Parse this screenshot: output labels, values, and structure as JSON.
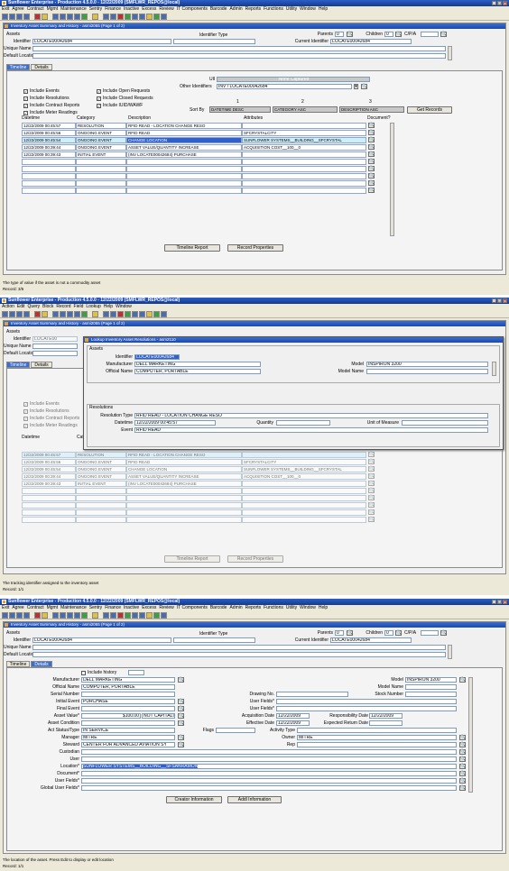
{
  "s1": {
    "title": "Sunflower Enterprise - Production 4.5.0.0 - 12/22/2009 (SMFLWR_REPOS@local)",
    "menu": [
      "Exit",
      "Agree",
      "Contract",
      "Mgmt",
      "Maintenance",
      "Sentry",
      "Finance",
      "Inactive",
      "Excess",
      "Review",
      "IT Components",
      "Barcode",
      "Admin",
      "Reports",
      "Functions",
      "Utility",
      "Window",
      "Help"
    ],
    "form_title": "Inventory Asset Summary and History - asmi2055 (Page 1 of 2)",
    "assets": "Assets",
    "identifier_label": "Identifier",
    "identifier": "LOCATE00042684",
    "identifier_type": "Identifier Type",
    "parents_label": "Parents",
    "parents": "0",
    "children_label": "Children",
    "children": "0",
    "cpa_label": "C/P/A",
    "current_identifier_label": "Current Identifier",
    "current_identifier": "LOCATE00042684",
    "unique_name_label": "Unique Name",
    "default_location_label": "Default Location*",
    "tabs": [
      "Timeline",
      "Details"
    ],
    "uii_label": "UII",
    "uii_value": "None Captured",
    "other_ids_label": "Other Identifiers",
    "other_ids": "INV / LOCATE00042684",
    "checks": [
      "Include Events",
      "Include Resolutions",
      "Include Contract Reports",
      "Include Meter Readings"
    ],
    "checks2": [
      "Include Open Requests",
      "Include Closed Requests",
      "Include IUID/WAWF"
    ],
    "sort_by": "Sort By",
    "n1": "1",
    "n2": "2",
    "n3": "3",
    "sort1": "DATETIME DESC",
    "sort2": "CATEGORY ASC",
    "sort3": "DESCRIPTION ASC",
    "get_records": "Get Records",
    "col_headers": [
      "Datetime",
      "Category",
      "Description",
      "Attributes",
      "Document?"
    ],
    "rows": [
      [
        "12/22/2009 00:45:57",
        "RESOLUTION",
        "RFID READ - LOCATION CHANGE RESO",
        ""
      ],
      [
        "12/22/2009 00:45:56",
        "ONGOING EVENT",
        "RFID READ",
        "SFCRYSTALCITY"
      ],
      [
        "12/22/2009 00:45:54",
        "ONGOING EVENT",
        "CHANGE LOCATION",
        "SUNFLOWER SYSTEMS__BUILDING__SFCRYSTAL"
      ],
      [
        "12/22/2009 00:39:44",
        "ONGOING EVENT",
        "ASSET VALUE/QUANTITY INCREASE",
        "ACQUISITION COST__100__0"
      ],
      [
        "12/22/2009 00:39:43",
        "INITIAL EVENT",
        "(INV LOCATE00042684) PURCHASE",
        ""
      ]
    ],
    "timeline_report": "Timeline Report",
    "record_properties": "Record Properties",
    "status": "The type of value if the asset is not a commodity asset",
    "record": "Record: 3/5"
  },
  "s2": {
    "title": "Sunflower Enterprise - Production 4.5.0.0 - 12/22/2009 (SMFLWR_REPOS@local)",
    "menu": [
      "Action",
      "Edit",
      "Query",
      "Block",
      "Record",
      "Field",
      "Lookup",
      "Help",
      "Window"
    ],
    "form_title": "Inventory Asset Summary and History - asmi2055 (Page 1 of 2)",
    "dlg_title": "Lookup Inventory Asset Resolutions - asm2110",
    "assets": "Assets",
    "identifier_label": "Identifier",
    "identifier": "LOCATE00042684",
    "manufacturer_label": "Manufacturer",
    "manufacturer": "DELL MARKETING",
    "official_name_label": "Official Name",
    "official_name": "COMPUTER, PORTABLE",
    "model_label": "Model",
    "model": "INSPIRON 3200",
    "model_name_label": "Model Name",
    "resolutions": "Resolutions",
    "res_type_label": "Resolution Type",
    "res_type": "RFID READ - LOCATION CHANGE RESO",
    "datetime_label": "Datetime",
    "datetime": "12/22/2009 00:45:57",
    "quantity_label": "Quantity",
    "uom_label": "Unit of Measure",
    "event_label": "Event",
    "event": "RFID READ",
    "bg_identifier": "LOCATE00",
    "unique_name_label": "Unique Name",
    "default_location_label": "Default Location*",
    "tabs": [
      "Timeline",
      "Details"
    ],
    "checks": [
      "Include Events",
      "Include Resolutions",
      "Include Contract Reports",
      "Include Meter Readings"
    ],
    "col_datetime": "Datetime",
    "col_cat": "Categ",
    "rows": [
      [
        "12/22/2009 00:45:57",
        "RESOLUTION",
        "RFID READ - LOCATION CHANGE RESO",
        ""
      ],
      [
        "12/22/2009 00:45:56",
        "ONGOING EVENT",
        "RFID READ",
        "SFCRYSTALCITY"
      ],
      [
        "12/22/2009 00:45:54",
        "ONGOING EVENT",
        "CHANGE LOCATION",
        "SUNFLOWER SYSTEMS__BUILDING__SFCRYSTAL"
      ],
      [
        "12/22/2009 00:39:44",
        "ONGOING EVENT",
        "ASSET VALUE/QUANTITY INCREASE",
        "ACQUISITION COST__100__0"
      ],
      [
        "12/22/2009 00:39:43",
        "INITIAL EVENT",
        "(INV LOCATE00042684) PURCHASE",
        ""
      ]
    ],
    "timeline_report": "Timeline Report",
    "record_properties": "Record Properties",
    "status": "The tracking identifier assigned to the inventory asset",
    "record": "Record: 1/1"
  },
  "s3": {
    "title": "Sunflower Enterprise - Production 4.5.0.0 - 12/22/2009 (SMFLWR_REPOS@local)",
    "menu": [
      "Exit",
      "Agree",
      "Contract",
      "Mgmt",
      "Maintenance",
      "Sentry",
      "Finance",
      "Inactive",
      "Excess",
      "Review",
      "IT Components",
      "Barcode",
      "Admin",
      "Reports",
      "Functions",
      "Utility",
      "Window",
      "Help"
    ],
    "form_title": "Inventory Asset Summary and History - asmi2055 (Page 1 of 2)",
    "assets": "Assets",
    "identifier_label": "Identifier",
    "identifier": "LOCATE00042684",
    "identifier_type": "Identifier Type",
    "parents_label": "Parents",
    "parents": "0",
    "children_label": "Children",
    "children": "0",
    "cpa_label": "C/P/A",
    "current_identifier_label": "Current Identifier",
    "current_identifier": "LOCATE00042684",
    "unique_name_label": "Unique Name",
    "default_location_label": "Default Location*",
    "tabs": [
      "Timeline",
      "Details"
    ],
    "include_history": "Include history",
    "manufacturer_label": "Manufacturer",
    "manufacturer": "DELL MARKETING",
    "official_name_label": "Official Name",
    "official_name": "COMPUTER, PORTABLE",
    "serial_label": "Serial Number",
    "initial_event_label": "Initial Event",
    "initial_event": "PURCHASE",
    "final_event_label": "Final Event",
    "asset_value_label": "Asset Value*",
    "asset_value": "$100.00",
    "asset_value_type": "NOT CAPITALIZ",
    "asset_condition_label": "Asset Condition",
    "act_status_label": "Act Status/Type",
    "act_status": "IN SERVICE",
    "manager_label": "Manager",
    "manager": "MITRE",
    "steward_label": "Steward",
    "steward": "CENTER FOR ADVANCED AVIATION SY",
    "custodian_label": "Custodian",
    "user_label": "User",
    "location_label": "Location*",
    "location": "SUNFLOWER SYSTEMS__BUILDING__SFSANRAMON",
    "document_label": "Document*",
    "user_fields_label": "User Fields*",
    "global_user_fields_label": "Global User Fields*",
    "model_label": "Model",
    "model": "INSPIRON 3200",
    "model_name_label": "Model Name",
    "drawing_label": "Drawing No.",
    "stock_label": "Stock Number",
    "user_fields_r1": "User Fields*",
    "user_fields_r2": "User Fields*",
    "acq_date_label": "Acquisition Date",
    "acq_date": "12/22/2009",
    "resp_date_label": "Responsibility Date",
    "resp_date": "12/22/2009",
    "eff_date_label": "Effective Date",
    "eff_date": "12/22/2009",
    "exp_return_label": "Expected Return Date",
    "flags_label": "Flags",
    "activity_label": "Activity Type",
    "owner_label": "Owner",
    "owner": "MITRE",
    "rep_label": "Rep",
    "creator_info": "Creator Information",
    "addl_info": "Addl Information",
    "status": "The location of the asset. Press Edit to display or edit location",
    "record": "Record: 1/1"
  },
  "colors": {
    "titlebar": "#1b4aa8",
    "selection": "#3060d0",
    "highlight_row": "#cdeffa",
    "tab_active": "#3a6fcf"
  }
}
